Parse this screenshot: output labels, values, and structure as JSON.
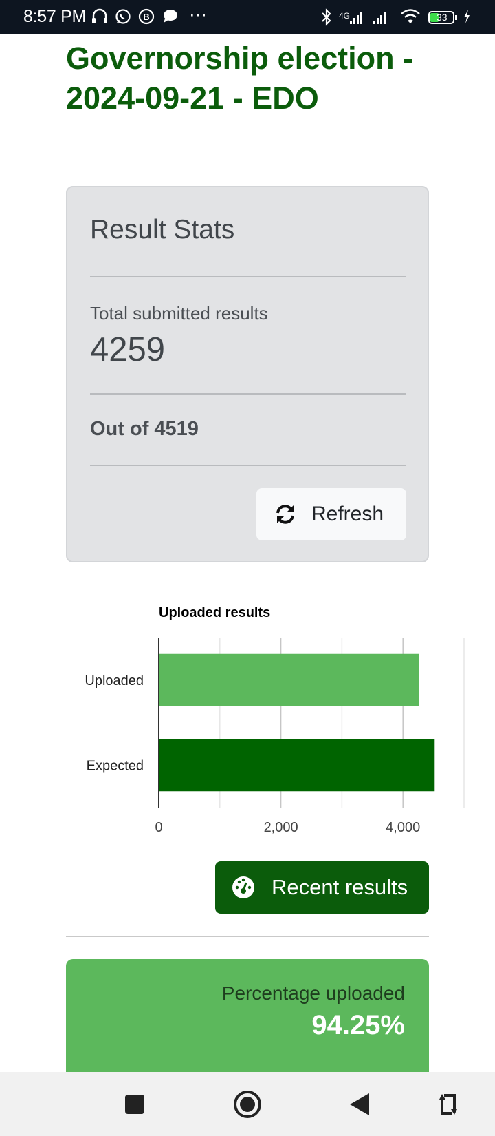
{
  "status_bar": {
    "time": "8:57 PM",
    "more": "···",
    "network": "4G",
    "battery": "33",
    "icons": [
      "headset-icon",
      "whatsapp-icon",
      "b-icon",
      "chat-bubble-icon",
      "bluetooth-icon",
      "signal-icon",
      "wifi-icon",
      "battery-icon",
      "charging-icon"
    ]
  },
  "page": {
    "title": "Governorship election - 2024-09-21 - EDO"
  },
  "stats": {
    "title": "Result Stats",
    "submitted_label": "Total submitted results",
    "submitted_value": "4259",
    "out_of": "Out of 4519",
    "refresh_label": "Refresh"
  },
  "chart_data": {
    "type": "bar",
    "orientation": "horizontal",
    "title": "Uploaded results",
    "categories": [
      "Uploaded",
      "Expected"
    ],
    "values": [
      4259,
      4519
    ],
    "colors": [
      "#5cb85c",
      "#006400"
    ],
    "xlim": [
      0,
      5000
    ],
    "x_ticks": [
      0,
      2000,
      4000
    ],
    "x_tick_labels": [
      "0",
      "2,000",
      "4,000"
    ],
    "xlabel": "",
    "ylabel": "",
    "grid": true
  },
  "actions": {
    "recent_results_label": "Recent results"
  },
  "percentage": {
    "label": "Percentage uploaded",
    "value": "94.25%"
  },
  "nav": {
    "buttons": [
      "recents-square-icon",
      "home-circle-icon",
      "back-triangle-icon",
      "rotate-icon"
    ]
  },
  "colors": {
    "title_green": "#0b5c0b",
    "uploaded_bar": "#5cb85c",
    "expected_bar": "#006400",
    "card_bg": "#e2e3e5",
    "percent_card_bg": "#5cb85c"
  }
}
